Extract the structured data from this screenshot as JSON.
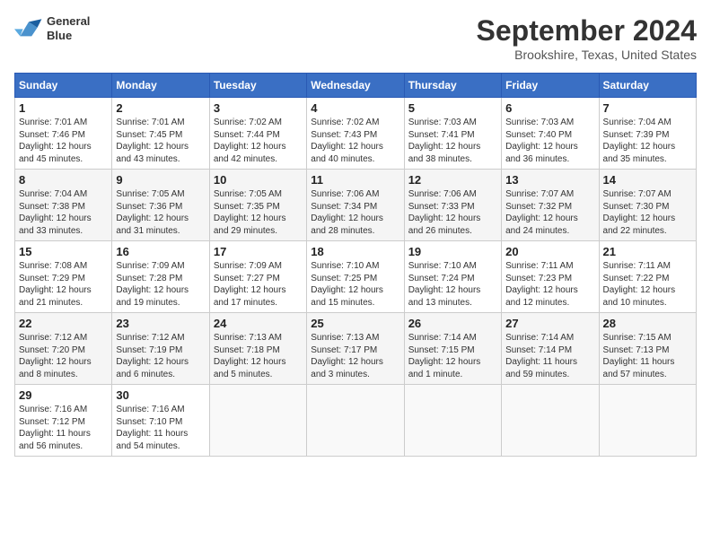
{
  "logo": {
    "line1": "General",
    "line2": "Blue"
  },
  "title": "September 2024",
  "location": "Brookshire, Texas, United States",
  "headers": [
    "Sunday",
    "Monday",
    "Tuesday",
    "Wednesday",
    "Thursday",
    "Friday",
    "Saturday"
  ],
  "weeks": [
    [
      {
        "day": "1",
        "info": "Sunrise: 7:01 AM\nSunset: 7:46 PM\nDaylight: 12 hours\nand 45 minutes."
      },
      {
        "day": "2",
        "info": "Sunrise: 7:01 AM\nSunset: 7:45 PM\nDaylight: 12 hours\nand 43 minutes."
      },
      {
        "day": "3",
        "info": "Sunrise: 7:02 AM\nSunset: 7:44 PM\nDaylight: 12 hours\nand 42 minutes."
      },
      {
        "day": "4",
        "info": "Sunrise: 7:02 AM\nSunset: 7:43 PM\nDaylight: 12 hours\nand 40 minutes."
      },
      {
        "day": "5",
        "info": "Sunrise: 7:03 AM\nSunset: 7:41 PM\nDaylight: 12 hours\nand 38 minutes."
      },
      {
        "day": "6",
        "info": "Sunrise: 7:03 AM\nSunset: 7:40 PM\nDaylight: 12 hours\nand 36 minutes."
      },
      {
        "day": "7",
        "info": "Sunrise: 7:04 AM\nSunset: 7:39 PM\nDaylight: 12 hours\nand 35 minutes."
      }
    ],
    [
      {
        "day": "8",
        "info": "Sunrise: 7:04 AM\nSunset: 7:38 PM\nDaylight: 12 hours\nand 33 minutes."
      },
      {
        "day": "9",
        "info": "Sunrise: 7:05 AM\nSunset: 7:36 PM\nDaylight: 12 hours\nand 31 minutes."
      },
      {
        "day": "10",
        "info": "Sunrise: 7:05 AM\nSunset: 7:35 PM\nDaylight: 12 hours\nand 29 minutes."
      },
      {
        "day": "11",
        "info": "Sunrise: 7:06 AM\nSunset: 7:34 PM\nDaylight: 12 hours\nand 28 minutes."
      },
      {
        "day": "12",
        "info": "Sunrise: 7:06 AM\nSunset: 7:33 PM\nDaylight: 12 hours\nand 26 minutes."
      },
      {
        "day": "13",
        "info": "Sunrise: 7:07 AM\nSunset: 7:32 PM\nDaylight: 12 hours\nand 24 minutes."
      },
      {
        "day": "14",
        "info": "Sunrise: 7:07 AM\nSunset: 7:30 PM\nDaylight: 12 hours\nand 22 minutes."
      }
    ],
    [
      {
        "day": "15",
        "info": "Sunrise: 7:08 AM\nSunset: 7:29 PM\nDaylight: 12 hours\nand 21 minutes."
      },
      {
        "day": "16",
        "info": "Sunrise: 7:09 AM\nSunset: 7:28 PM\nDaylight: 12 hours\nand 19 minutes."
      },
      {
        "day": "17",
        "info": "Sunrise: 7:09 AM\nSunset: 7:27 PM\nDaylight: 12 hours\nand 17 minutes."
      },
      {
        "day": "18",
        "info": "Sunrise: 7:10 AM\nSunset: 7:25 PM\nDaylight: 12 hours\nand 15 minutes."
      },
      {
        "day": "19",
        "info": "Sunrise: 7:10 AM\nSunset: 7:24 PM\nDaylight: 12 hours\nand 13 minutes."
      },
      {
        "day": "20",
        "info": "Sunrise: 7:11 AM\nSunset: 7:23 PM\nDaylight: 12 hours\nand 12 minutes."
      },
      {
        "day": "21",
        "info": "Sunrise: 7:11 AM\nSunset: 7:22 PM\nDaylight: 12 hours\nand 10 minutes."
      }
    ],
    [
      {
        "day": "22",
        "info": "Sunrise: 7:12 AM\nSunset: 7:20 PM\nDaylight: 12 hours\nand 8 minutes."
      },
      {
        "day": "23",
        "info": "Sunrise: 7:12 AM\nSunset: 7:19 PM\nDaylight: 12 hours\nand 6 minutes."
      },
      {
        "day": "24",
        "info": "Sunrise: 7:13 AM\nSunset: 7:18 PM\nDaylight: 12 hours\nand 5 minutes."
      },
      {
        "day": "25",
        "info": "Sunrise: 7:13 AM\nSunset: 7:17 PM\nDaylight: 12 hours\nand 3 minutes."
      },
      {
        "day": "26",
        "info": "Sunrise: 7:14 AM\nSunset: 7:15 PM\nDaylight: 12 hours\nand 1 minute."
      },
      {
        "day": "27",
        "info": "Sunrise: 7:14 AM\nSunset: 7:14 PM\nDaylight: 11 hours\nand 59 minutes."
      },
      {
        "day": "28",
        "info": "Sunrise: 7:15 AM\nSunset: 7:13 PM\nDaylight: 11 hours\nand 57 minutes."
      }
    ],
    [
      {
        "day": "29",
        "info": "Sunrise: 7:16 AM\nSunset: 7:12 PM\nDaylight: 11 hours\nand 56 minutes."
      },
      {
        "day": "30",
        "info": "Sunrise: 7:16 AM\nSunset: 7:10 PM\nDaylight: 11 hours\nand 54 minutes."
      },
      {
        "day": "",
        "info": ""
      },
      {
        "day": "",
        "info": ""
      },
      {
        "day": "",
        "info": ""
      },
      {
        "day": "",
        "info": ""
      },
      {
        "day": "",
        "info": ""
      }
    ]
  ]
}
